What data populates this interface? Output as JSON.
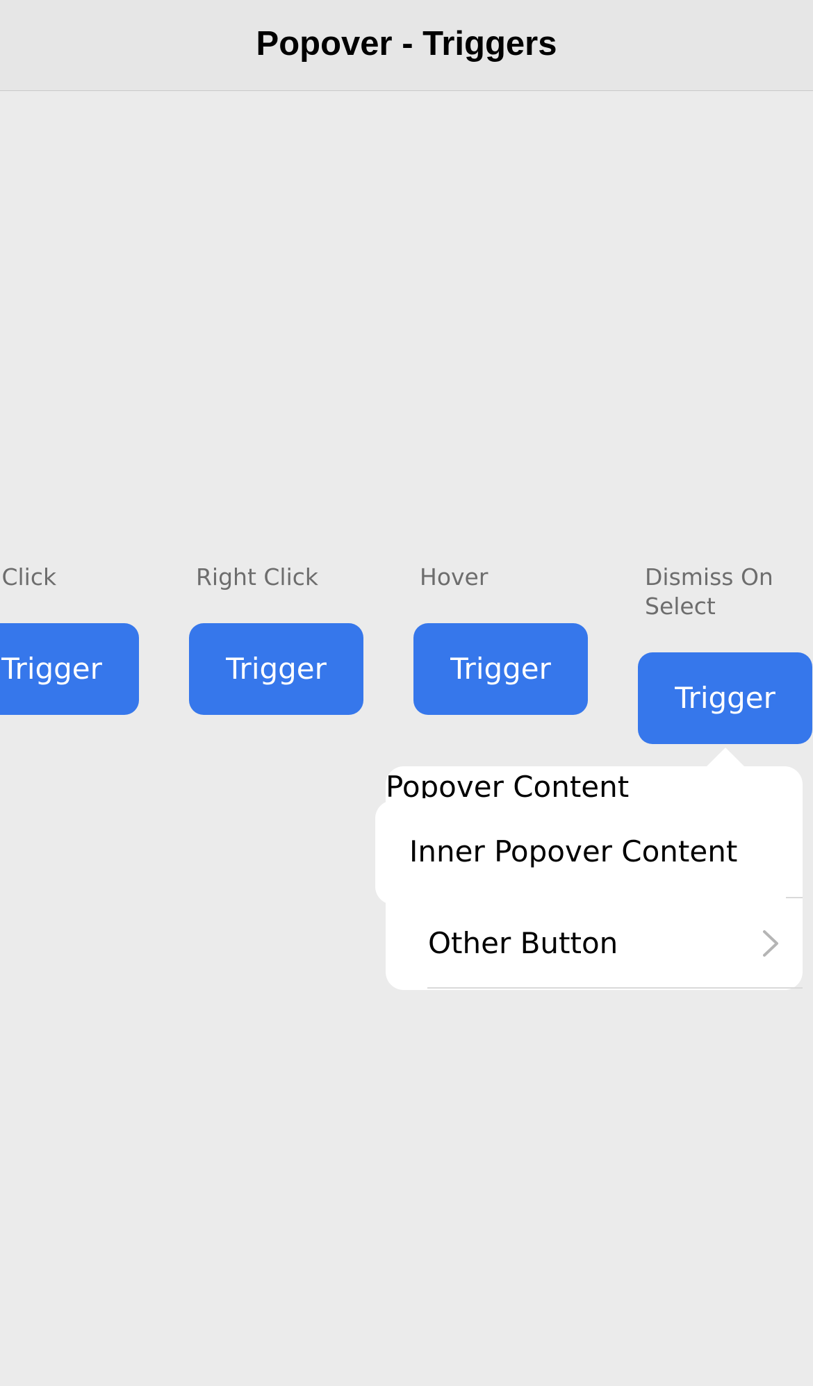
{
  "navbar": {
    "title": "Popover - Triggers"
  },
  "groups": [
    {
      "label": "ft Click",
      "trigger_label": "Trigger"
    },
    {
      "label": "Right Click",
      "trigger_label": "Trigger"
    },
    {
      "label": "Hover",
      "trigger_label": "Trigger"
    },
    {
      "label_line1": "Dismiss On",
      "label_line2": "Select",
      "trigger_label": "Trigger"
    }
  ],
  "popover": {
    "title": "Popover Content",
    "inner_content": "Inner Popover Content",
    "other_button_label": "Other Button",
    "chevron_icon": "chevron-right-icon"
  },
  "colors": {
    "background": "#ebebeb",
    "navbar": "#e6e6e6",
    "trigger_button": "#3677eb",
    "label_text": "#6d6d6d",
    "popover": "#ffffff"
  }
}
